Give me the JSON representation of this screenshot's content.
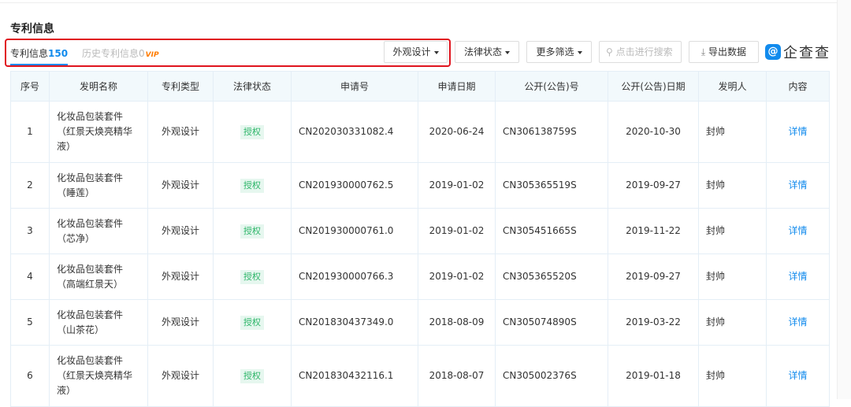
{
  "section_title": "专利信息",
  "tabs": [
    {
      "label": "专利信息",
      "count": "150"
    },
    {
      "label": "历史专利信息",
      "count": "0",
      "badge": "VIP"
    }
  ],
  "filters": {
    "type": "外观设计",
    "legal_status": "法律状态",
    "more": "更多筛选"
  },
  "search": {
    "placeholder": "点击进行搜索"
  },
  "export_label": "导出数据",
  "logo_text": "企查查",
  "columns": [
    "序号",
    "发明名称",
    "专利类型",
    "法律状态",
    "申请号",
    "申请日期",
    "公开(公告)号",
    "公开(公告)日期",
    "发明人",
    "内容"
  ],
  "rows": [
    {
      "no": "1",
      "name": "化妆品包装套件（红景天焕亮精华液）",
      "type": "外观设计",
      "status": "授权",
      "app_no": "CN202030331082.4",
      "app_date": "2020-06-24",
      "pub_no": "CN306138759S",
      "pub_date": "2020-10-30",
      "inventor": "封帅",
      "detail": "详情"
    },
    {
      "no": "2",
      "name": "化妆品包装套件（睡莲）",
      "type": "外观设计",
      "status": "授权",
      "app_no": "CN201930000762.5",
      "app_date": "2019-01-02",
      "pub_no": "CN305365519S",
      "pub_date": "2019-09-27",
      "inventor": "封帅",
      "detail": "详情"
    },
    {
      "no": "3",
      "name": "化妆品包装套件（芯净）",
      "type": "外观设计",
      "status": "授权",
      "app_no": "CN201930000761.0",
      "app_date": "2019-01-02",
      "pub_no": "CN305451665S",
      "pub_date": "2019-11-22",
      "inventor": "封帅",
      "detail": "详情"
    },
    {
      "no": "4",
      "name": "化妆品包装套件（高端红景天）",
      "type": "外观设计",
      "status": "授权",
      "app_no": "CN201930000766.3",
      "app_date": "2019-01-02",
      "pub_no": "CN305365520S",
      "pub_date": "2019-09-27",
      "inventor": "封帅",
      "detail": "详情"
    },
    {
      "no": "5",
      "name": "化妆品包装套件（山茶花）",
      "type": "外观设计",
      "status": "授权",
      "app_no": "CN201830437349.0",
      "app_date": "2018-08-09",
      "pub_no": "CN305074890S",
      "pub_date": "2019-03-22",
      "inventor": "封帅",
      "detail": "详情"
    },
    {
      "no": "6",
      "name": "化妆品包装套件（红景天焕亮精华液）",
      "type": "外观设计",
      "status": "授权",
      "app_no": "CN201830432116.1",
      "app_date": "2018-08-07",
      "pub_no": "CN305002376S",
      "pub_date": "2019-01-18",
      "inventor": "封帅",
      "detail": "详情"
    }
  ]
}
